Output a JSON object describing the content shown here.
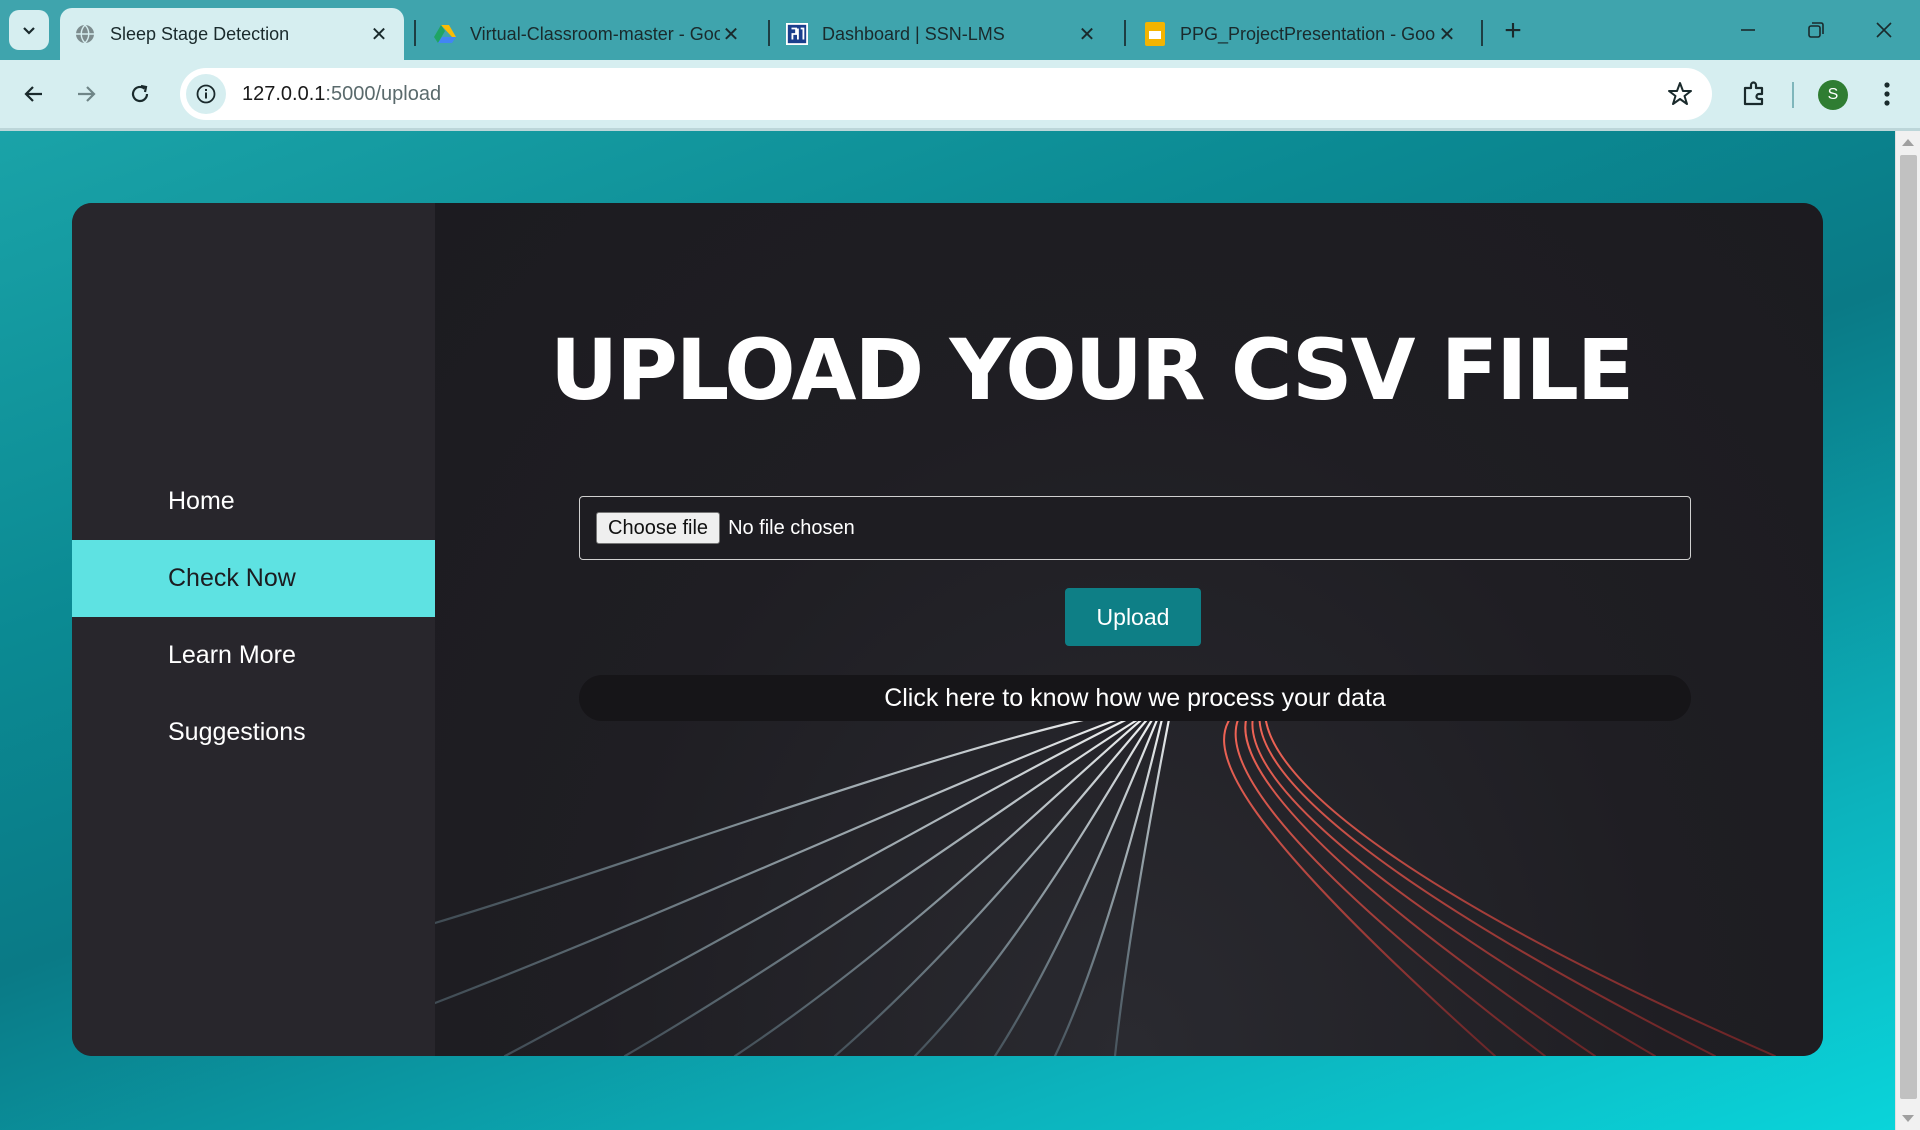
{
  "browser": {
    "tabs": [
      {
        "title": "Sleep Stage Detection",
        "active": true,
        "icon": "globe-icon"
      },
      {
        "title": "Virtual-Classroom-master - Goo",
        "active": false,
        "icon": "google-drive-icon"
      },
      {
        "title": "Dashboard | SSN-LMS",
        "active": false,
        "icon": "ssn-logo-icon"
      },
      {
        "title": "PPG_ProjectPresentation - Goo",
        "active": false,
        "icon": "google-slides-icon"
      }
    ],
    "address": {
      "host": "127.0.0.1",
      "path": ":5000/upload"
    },
    "profile_initial": "S",
    "colors": {
      "chrome": "#3fa4ad",
      "toolbar": "#d6eef0",
      "avatar": "#2f7d32"
    }
  },
  "sidebar": {
    "items": [
      {
        "label": "Home",
        "active": false
      },
      {
        "label": "Check Now",
        "active": true
      },
      {
        "label": "Learn More",
        "active": false
      },
      {
        "label": "Suggestions",
        "active": false
      }
    ]
  },
  "main": {
    "heading": "UPLOAD YOUR CSV FILE",
    "file_input": {
      "button_label": "Choose file",
      "status": "No file chosen"
    },
    "upload_label": "Upload",
    "info_link": "Click here to know how we process your data"
  },
  "theme": {
    "accent": "#5ee2e2",
    "upload_button": "#0e7f86",
    "card": "#1e1d22",
    "sidebar": "#28262c"
  }
}
